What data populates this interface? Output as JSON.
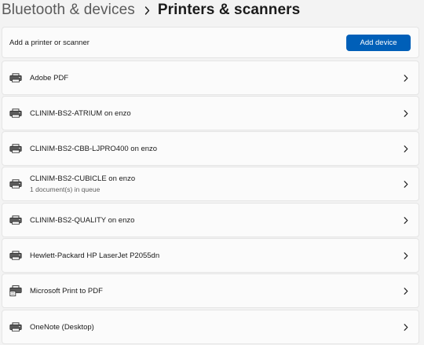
{
  "header": {
    "parent": "Bluetooth & devices",
    "current": "Printers & scanners"
  },
  "add_section": {
    "label": "Add a printer or scanner",
    "button": "Add device"
  },
  "printers": [
    {
      "name": "Adobe PDF",
      "status": "",
      "icon": "printer-icon"
    },
    {
      "name": "CLINIM-BS2-ATRIUM on enzo",
      "status": "",
      "icon": "printer-icon"
    },
    {
      "name": "CLINIM-BS2-CBB-LJPRO400 on enzo",
      "status": "",
      "icon": "printer-icon"
    },
    {
      "name": "CLINIM-BS2-CUBICLE on enzo",
      "status": "1 document(s) in queue",
      "icon": "printer-icon"
    },
    {
      "name": "CLINIM-BS2-QUALITY on enzo",
      "status": "",
      "icon": "printer-icon"
    },
    {
      "name": "Hewlett-Packard HP LaserJet P2055dn",
      "status": "",
      "icon": "printer-icon"
    },
    {
      "name": "Microsoft Print to PDF",
      "status": "",
      "icon": "pdf-printer-icon"
    },
    {
      "name": "OneNote (Desktop)",
      "status": "",
      "icon": "printer-icon"
    }
  ],
  "colors": {
    "accent": "#005fb8",
    "background": "#f3f3f3",
    "card": "#fbfbfb"
  }
}
